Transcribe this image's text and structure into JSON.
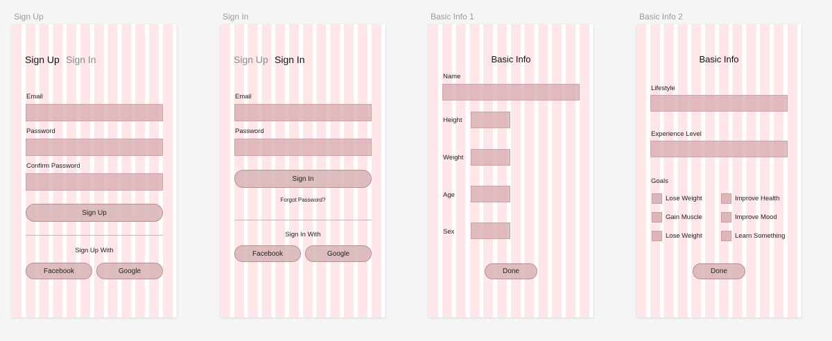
{
  "frames": {
    "signup": {
      "label": "Sign Up",
      "tab_signup": "Sign Up",
      "tab_signin": "Sign In",
      "email_label": "Email",
      "password_label": "Password",
      "confirm_label": "Confirm Password",
      "submit": "Sign Up",
      "with_text": "Sign Up With",
      "facebook": "Facebook",
      "google": "Google"
    },
    "signin": {
      "label": "Sign In",
      "tab_signup": "Sign Up",
      "tab_signin": "Sign In",
      "email_label": "Email",
      "password_label": "Password",
      "submit": "Sign In",
      "forgot": "Forgot Password?",
      "with_text": "Sign In With",
      "facebook": "Facebook",
      "google": "Google"
    },
    "basic1": {
      "label": "Basic Info 1",
      "title": "Basic Info",
      "name_label": "Name",
      "height_label": "Height",
      "weight_label": "Weight",
      "age_label": "Age",
      "sex_label": "Sex",
      "done": "Done"
    },
    "basic2": {
      "label": "Basic Info 2",
      "title": "Basic Info",
      "lifestyle_label": "Lifestyle",
      "experience_label": "Experience Level",
      "goals_label": "Goals",
      "goals": [
        "Lose Weight",
        "Improve Health",
        "Gain Muscle",
        "Improve Mood",
        "Lose Weight",
        "Learn Something"
      ],
      "done": "Done"
    }
  }
}
